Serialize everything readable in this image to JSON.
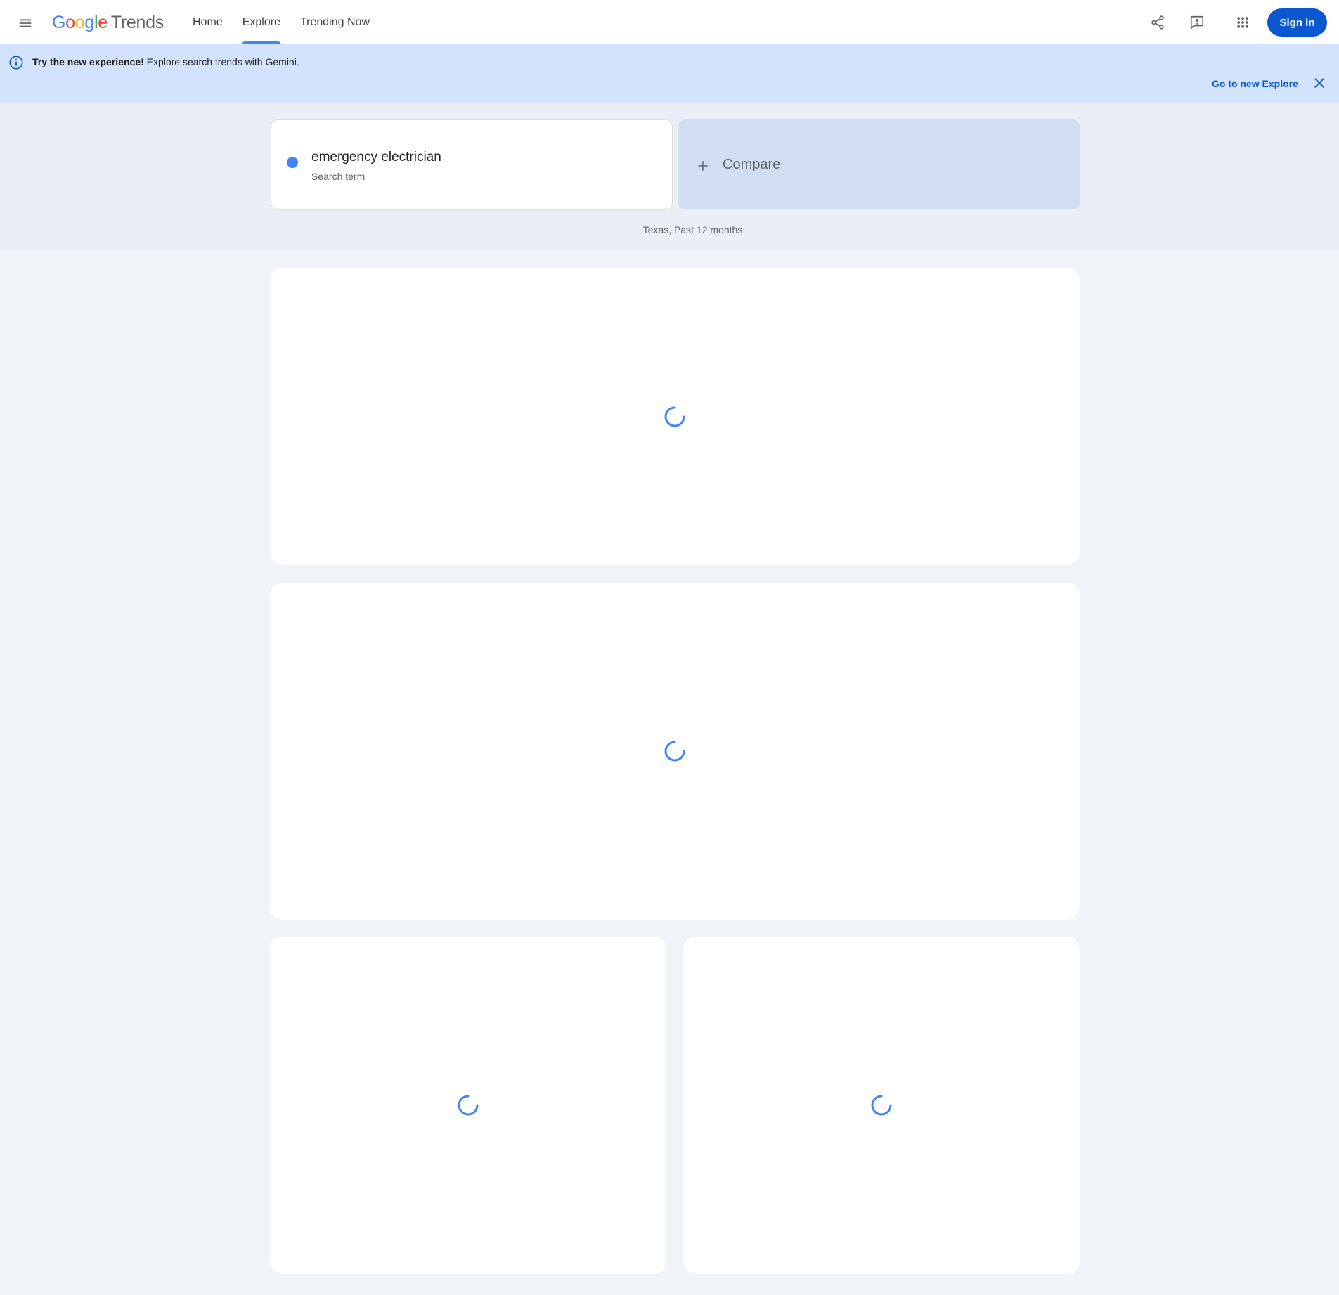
{
  "header": {
    "logo": {
      "g1": "G",
      "o1": "o",
      "o2": "o",
      "g2": "g",
      "l": "l",
      "e": "e",
      "product": "Trends"
    },
    "nav": [
      {
        "label": "Home",
        "active": false
      },
      {
        "label": "Explore",
        "active": true
      },
      {
        "label": "Trending Now",
        "active": false
      }
    ],
    "icons": {
      "menu": "menu-icon",
      "share": "share-icon",
      "feedback": "feedback-icon",
      "apps": "apps-grid-icon"
    },
    "sign_in_label": "Sign in"
  },
  "banner": {
    "bold_text": "Try the new experience!",
    "text": "Explore search trends with Gemini.",
    "link_label": "Go to new Explore",
    "icons": {
      "info": "info-icon",
      "close": "close-icon"
    }
  },
  "explore": {
    "term": {
      "value": "emergency electrician",
      "type_label": "Search term",
      "color": "#4285f4"
    },
    "compare_label": "Compare",
    "filter_summary": "Texas, Past 12 months"
  },
  "colors": {
    "accent": "#4285f4",
    "primary_button": "#0b57d0",
    "banner_bg": "#d3e3fd",
    "page_bg": "#f0f3f8"
  },
  "panels": [
    {
      "name": "interest-over-time-panel",
      "state": "loading"
    },
    {
      "name": "interest-by-subregion-panel",
      "state": "loading"
    },
    {
      "name": "related-topics-panel",
      "state": "loading"
    },
    {
      "name": "related-queries-panel",
      "state": "loading"
    }
  ]
}
